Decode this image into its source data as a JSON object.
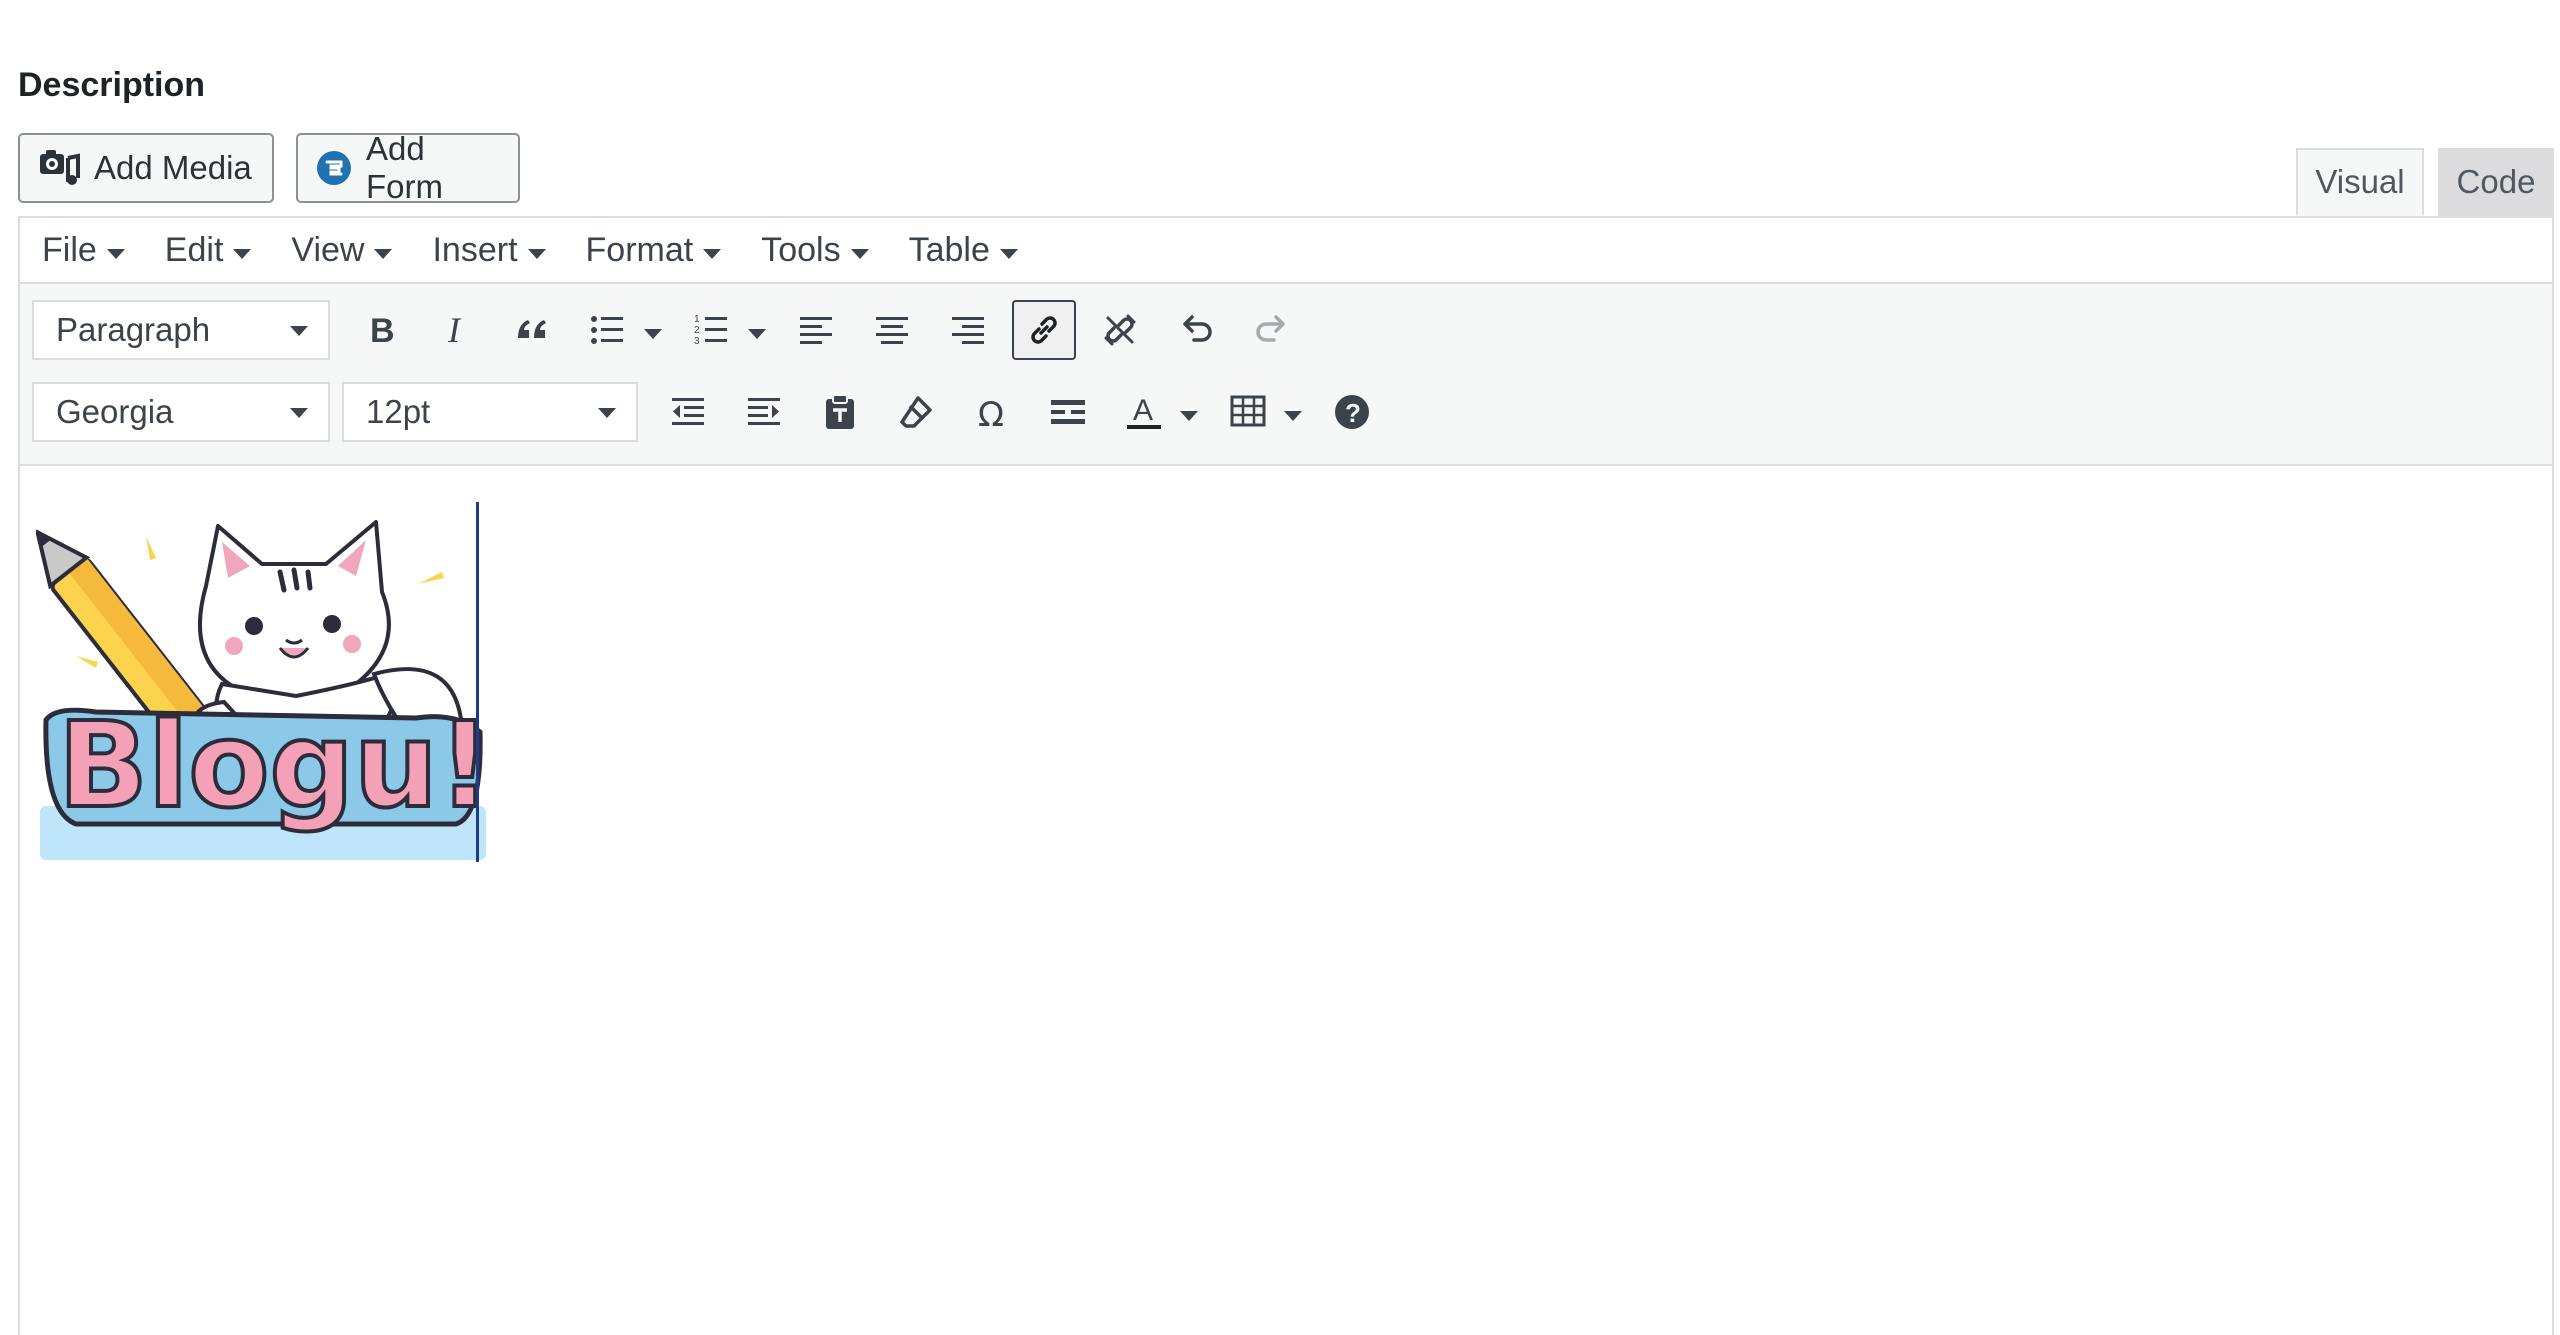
{
  "section": {
    "label": "Description"
  },
  "media_buttons": {
    "add_media": "Add Media",
    "add_form": "Add Form"
  },
  "editor_tabs": {
    "visual": "Visual",
    "code": "Code",
    "active": "visual"
  },
  "menubar": [
    {
      "label": "File"
    },
    {
      "label": "Edit"
    },
    {
      "label": "View"
    },
    {
      "label": "Insert"
    },
    {
      "label": "Format"
    },
    {
      "label": "Tools"
    },
    {
      "label": "Table"
    }
  ],
  "toolbar": {
    "block_format": "Paragraph",
    "font_family": "Georgia",
    "font_size": "12pt",
    "special_char_glyph": "Ω",
    "text_color_glyph": "A",
    "help_glyph": "?"
  },
  "content": {
    "image_text": "Blogu!",
    "image_icon": "cat-with-pencil-logo-icon"
  },
  "colors": {
    "accent": "#2271b1",
    "toolbar_bg": "#f6f7f7",
    "border": "#dcdcde",
    "text": "#3c434a"
  }
}
